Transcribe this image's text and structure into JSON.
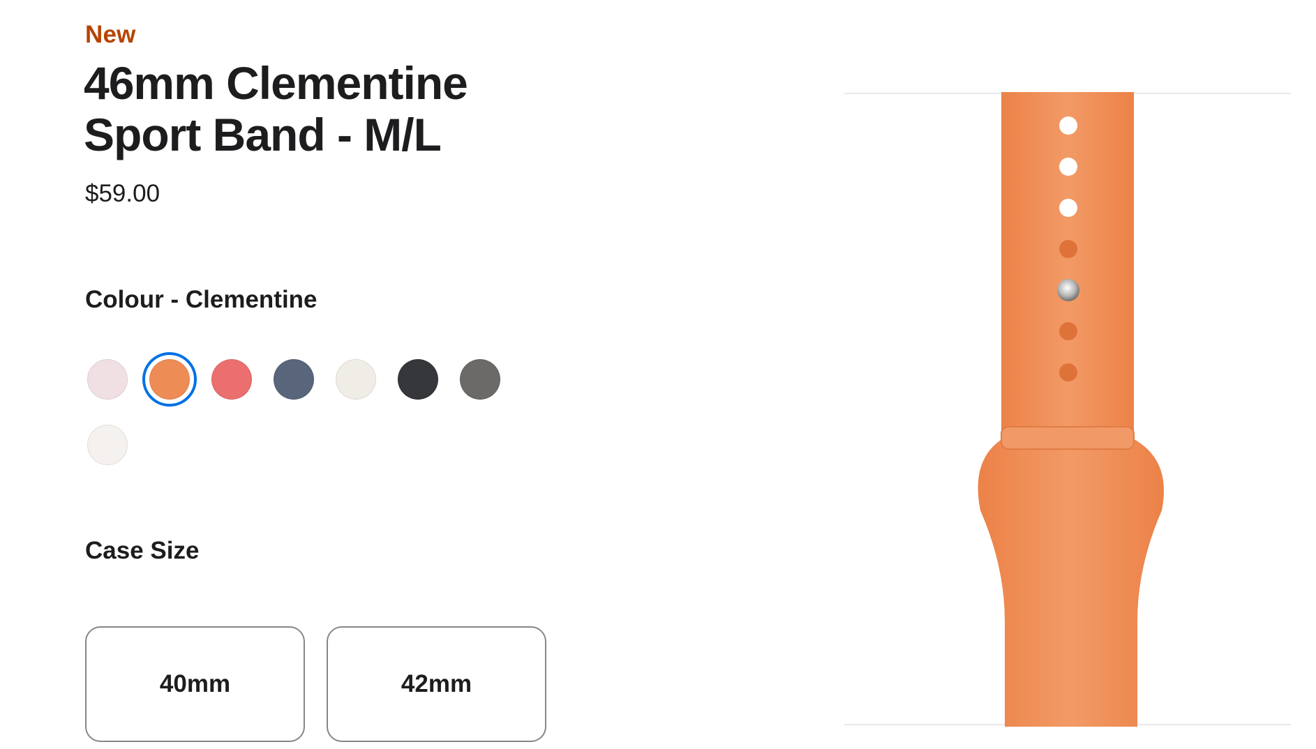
{
  "product": {
    "badge": "New",
    "title_line1": "46mm Clementine",
    "title_line2": "Sport Band - M/L",
    "price": "$59.00"
  },
  "colour": {
    "label": "Colour - Clementine",
    "selected": "Clementine",
    "swatches": [
      {
        "color": "#f0e0e3",
        "selected": false
      },
      {
        "color": "#ee8c56",
        "selected": true
      },
      {
        "color": "#ea6f6e",
        "selected": false
      },
      {
        "color": "#58657a",
        "selected": false
      },
      {
        "color": "#efede6",
        "selected": false
      },
      {
        "color": "#36373a",
        "selected": false
      },
      {
        "color": "#6b6a68",
        "selected": false
      },
      {
        "color": "#f4f1ef",
        "selected": false
      }
    ]
  },
  "case_size": {
    "label": "Case Size",
    "options": [
      "40mm",
      "42mm"
    ]
  },
  "theme": {
    "accent": "#0071e3",
    "badge_color": "#b64400",
    "band_color": "#f08d57"
  }
}
